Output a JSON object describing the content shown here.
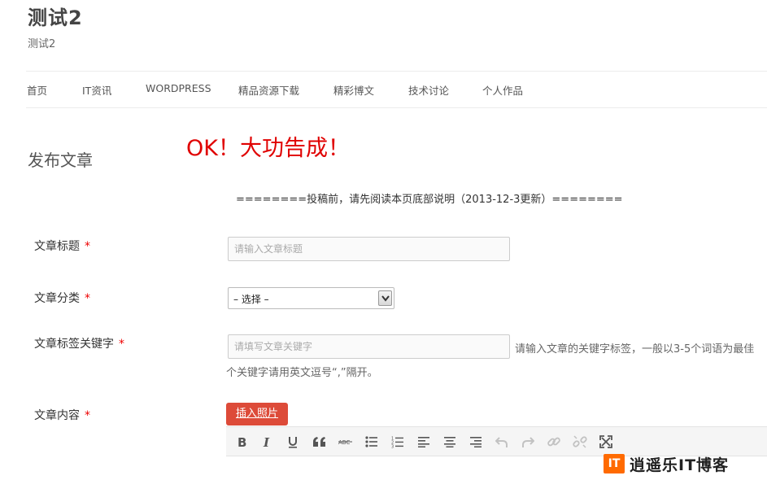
{
  "site": {
    "title": "测试2",
    "description": "测试2"
  },
  "nav": {
    "items": [
      {
        "label": "首页"
      },
      {
        "label": "IT资讯"
      },
      {
        "label": "WORDPRESS"
      },
      {
        "label": "精品资源下载"
      },
      {
        "label": "精彩博文"
      },
      {
        "label": "技术讨论"
      },
      {
        "label": "个人作品"
      }
    ]
  },
  "page": {
    "title": "发布文章",
    "success_message": "OK！大功告成！",
    "notice": "========投稿前，请先阅读本页底部说明（2013-12-3更新）========"
  },
  "form": {
    "required_mark": "*",
    "title_label": "文章标题",
    "title_placeholder": "请输入文章标题",
    "category_label": "文章分类",
    "category_selected": "– 选择 –",
    "tags_label": "文章标签关键字",
    "tags_placeholder": "请填写文章关键字",
    "tags_hint_line1": "请输入文章的关键字标签，一般以3-5个词语为最佳",
    "tags_hint_line2": "个关键字请用英文逗号“,”隔开。",
    "content_label": "文章内容",
    "insert_image_label": "插入照片"
  },
  "editor": {
    "toolbar_icons": [
      "bold-icon",
      "italic-icon",
      "underline-icon",
      "blockquote-icon",
      "strikethrough-icon",
      "bullet-list-icon",
      "numbered-list-icon",
      "align-left-icon",
      "align-center-icon",
      "align-right-icon",
      "undo-icon",
      "redo-icon",
      "link-icon",
      "unlink-icon",
      "fullscreen-icon"
    ]
  },
  "watermark": {
    "logo_text": "IT",
    "text": "逍遥乐IT博客"
  },
  "colors": {
    "success": "#e00000",
    "required": "#ee0000",
    "button_bg": "#dd4b39",
    "watermark_logo": "#ff6a00"
  }
}
